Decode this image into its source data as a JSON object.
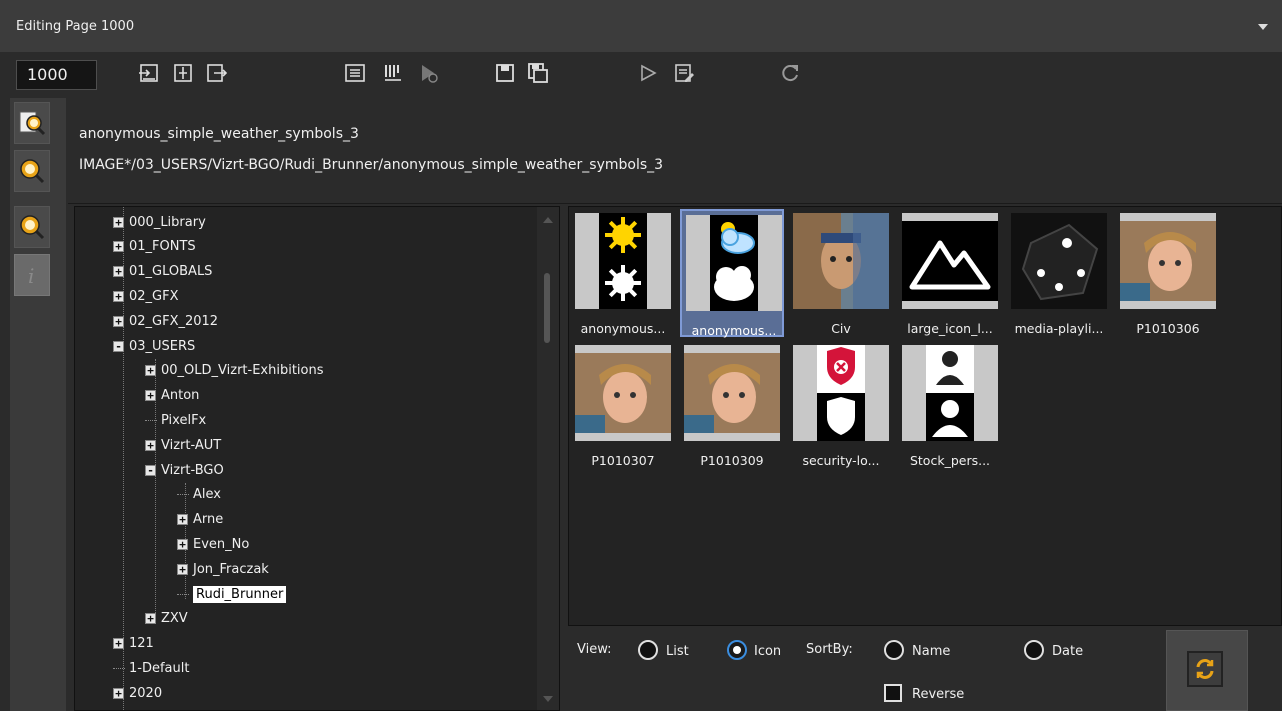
{
  "window": {
    "title": "Editing Page 1000"
  },
  "toolbar": {
    "page_number": "1000",
    "buttons": [
      "import-icon",
      "split-icon",
      "export-icon",
      "insert-icon",
      "stack-icon",
      "scheduled-play-icon",
      "save-icon",
      "save-as-icon",
      "play-icon",
      "edit-icon",
      "reload-icon"
    ]
  },
  "sidebar": {
    "buttons": [
      "browse-folder-icon",
      "search-icon",
      "zoom-search-icon",
      "info-icon"
    ]
  },
  "asset": {
    "name": "anonymous_simple_weather_symbols_3",
    "path": "IMAGE*/03_USERS/Vizrt-BGO/Rudi_Brunner/anonymous_simple_weather_symbols_3"
  },
  "tree": [
    {
      "label": "000_Library",
      "level": 0,
      "expander": "+"
    },
    {
      "label": "01_FONTS",
      "level": 0,
      "expander": "+"
    },
    {
      "label": "01_GLOBALS",
      "level": 0,
      "expander": "+"
    },
    {
      "label": "02_GFX",
      "level": 0,
      "expander": "+"
    },
    {
      "label": "02_GFX_2012",
      "level": 0,
      "expander": "+"
    },
    {
      "label": "03_USERS",
      "level": 0,
      "expander": "-"
    },
    {
      "label": "00_OLD_Vizrt-Exhibitions",
      "level": 1,
      "expander": "+"
    },
    {
      "label": "Anton",
      "level": 1,
      "expander": "+"
    },
    {
      "label": "PixelFx",
      "level": 1,
      "expander": ""
    },
    {
      "label": "Vizrt-AUT",
      "level": 1,
      "expander": "+"
    },
    {
      "label": "Vizrt-BGO",
      "level": 1,
      "expander": "-"
    },
    {
      "label": "Alex",
      "level": 2,
      "expander": ""
    },
    {
      "label": "Arne",
      "level": 2,
      "expander": "+"
    },
    {
      "label": "Even_No",
      "level": 2,
      "expander": "+"
    },
    {
      "label": "Jon_Fraczak",
      "level": 2,
      "expander": "+"
    },
    {
      "label": "Rudi_Brunner",
      "level": 2,
      "expander": "",
      "selected": true
    },
    {
      "label": "ZXV",
      "level": 1,
      "expander": "+"
    },
    {
      "label": "121",
      "level": 0,
      "expander": "+"
    },
    {
      "label": "1-Default",
      "level": 0,
      "expander": ""
    },
    {
      "label": "2020",
      "level": 0,
      "expander": "+"
    }
  ],
  "thumbnails": [
    {
      "caption": "anonymous...",
      "thumb": "weather-sun-icon"
    },
    {
      "caption": "anonymous...",
      "thumb": "weather-cloud-icon",
      "selected": true
    },
    {
      "caption": "Civ",
      "thumb": "civ-portrait-image"
    },
    {
      "caption": "large_icon_l...",
      "thumb": "mountain-icon"
    },
    {
      "caption": "media-playli...",
      "thumb": "dice-image"
    },
    {
      "caption": "P1010306",
      "thumb": "child-photo"
    },
    {
      "caption": "P1010307",
      "thumb": "child-photo"
    },
    {
      "caption": "P1010309",
      "thumb": "child-photo"
    },
    {
      "caption": "security-lo...",
      "thumb": "shield-icon"
    },
    {
      "caption": "Stock_pers...",
      "thumb": "person-icon"
    }
  ],
  "view": {
    "view_label": "View:",
    "list_label": "List",
    "icon_label": "Icon",
    "selected_view": "Icon",
    "sortby_label": "SortBy:",
    "name_label": "Name",
    "date_label": "Date",
    "reverse_label": "Reverse"
  },
  "colors": {
    "background": "#2b2b2b",
    "panel": "#232323",
    "selection": "#5a6e96",
    "radio_on": "#3b8ee0",
    "icon_orange": "#e8a317"
  }
}
